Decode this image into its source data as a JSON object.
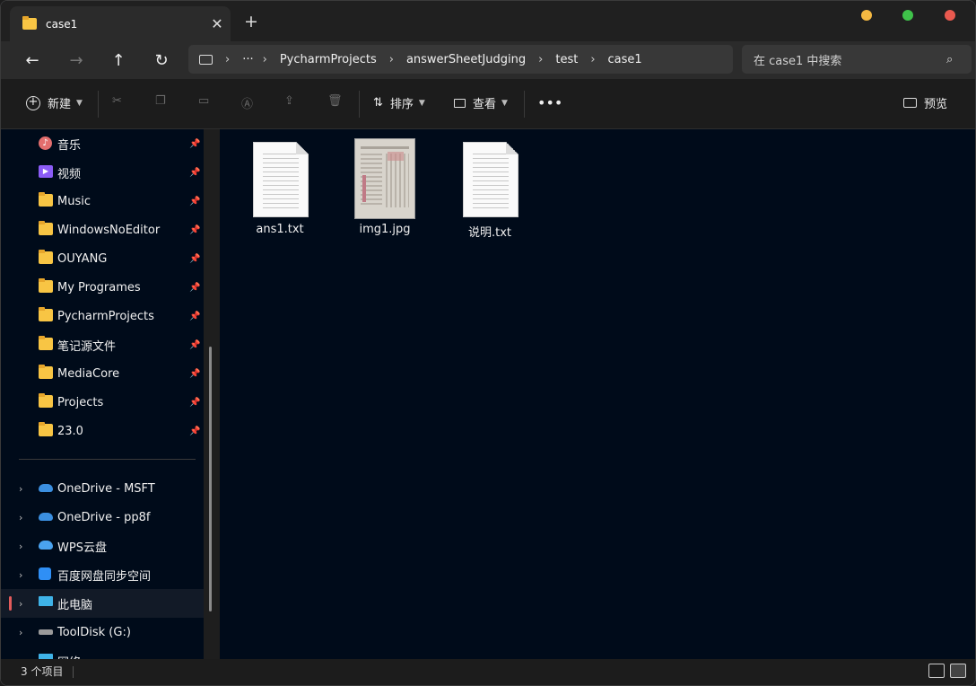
{
  "tab": {
    "title": "case1"
  },
  "window_controls": {
    "minimize_color": "#f5b942",
    "maximize_color": "#3fc24a",
    "close_color": "#e9594f"
  },
  "breadcrumb": [
    "PycharmProjects",
    "answerSheetJudging",
    "test",
    "case1"
  ],
  "search": {
    "placeholder": "在 case1 中搜索"
  },
  "toolbar": {
    "new_label": "新建",
    "sort_label": "排序",
    "view_label": "查看",
    "preview_label": "预览"
  },
  "sidebar": {
    "quick_access": [
      {
        "label": "音乐",
        "icon": "music-icon"
      },
      {
        "label": "视频",
        "icon": "video-icon"
      },
      {
        "label": "Music",
        "icon": "folder-icon"
      },
      {
        "label": "WindowsNoEditor",
        "icon": "folder-icon"
      },
      {
        "label": "OUYANG",
        "icon": "folder-icon"
      },
      {
        "label": "My Programes",
        "icon": "folder-icon"
      },
      {
        "label": "PycharmProjects",
        "icon": "folder-icon"
      },
      {
        "label": "笔记源文件",
        "icon": "folder-icon"
      },
      {
        "label": "MediaCore",
        "icon": "folder-icon"
      },
      {
        "label": "Projects",
        "icon": "folder-icon"
      },
      {
        "label": "23.0",
        "icon": "folder-icon"
      }
    ],
    "locations": [
      {
        "label": "OneDrive - MSFT",
        "icon": "onedrive-icon"
      },
      {
        "label": "OneDrive - pp8f",
        "icon": "onedrive-icon"
      },
      {
        "label": "WPS云盘",
        "icon": "wps-cloud-icon"
      },
      {
        "label": "百度网盘同步空间",
        "icon": "baidu-netdisk-icon"
      },
      {
        "label": "此电脑",
        "icon": "computer-icon",
        "selected": true
      },
      {
        "label": "ToolDisk (G:)",
        "icon": "drive-icon"
      },
      {
        "label": "网络",
        "icon": "network-icon"
      }
    ]
  },
  "files": [
    {
      "name": "ans1.txt",
      "type": "text-file-icon"
    },
    {
      "name": "img1.jpg",
      "type": "image-thumbnail"
    },
    {
      "name": "说明.txt",
      "type": "text-file-icon"
    }
  ],
  "status": {
    "count": "3 个项目"
  }
}
